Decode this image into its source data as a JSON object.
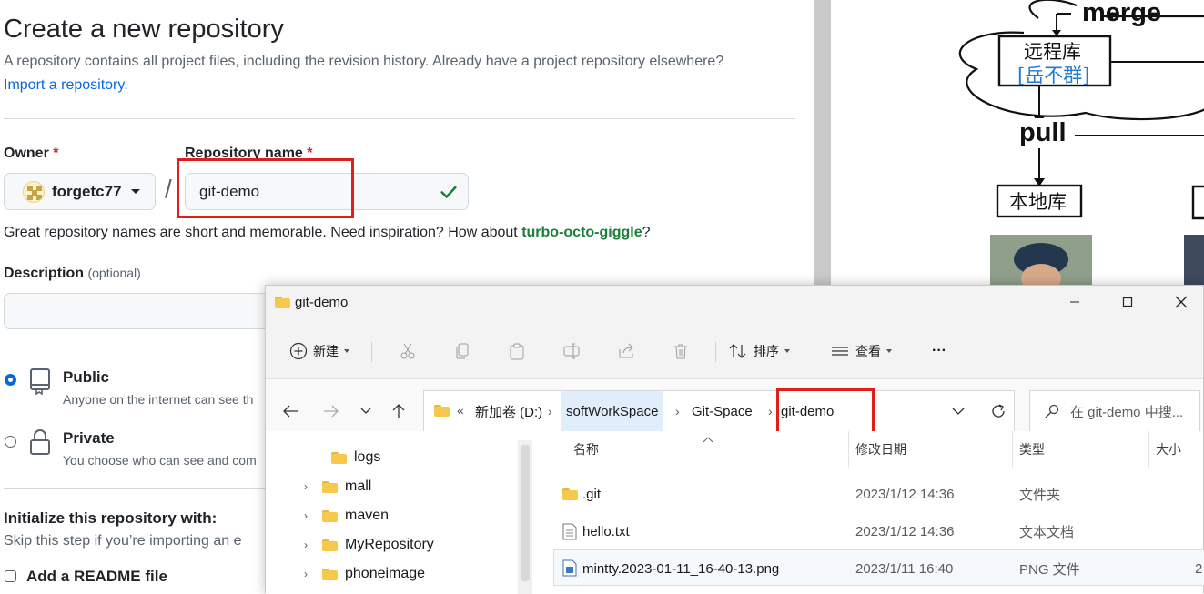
{
  "github": {
    "title": "Create a new repository",
    "subtitle": "A repository contains all project files, including the revision history. Already have a project repository elsewhere?",
    "import_link": "Import a repository.",
    "owner_label": "Owner",
    "required_mark": "*",
    "owner_value": "forgetc77",
    "repo_label": "Repository name",
    "slash": "/",
    "repo_value": "git-demo",
    "hint_prefix": "Great repository names are short and memorable. Need inspiration? How about ",
    "hint_suggestion": "turbo-octo-giggle",
    "hint_suffix": "?",
    "description_label": "Description",
    "description_optional": "(optional)",
    "public_title": "Public",
    "public_desc": "Anyone on the internet can see th",
    "private_title": "Private",
    "private_desc": "You choose who can see and com",
    "init_title": "Initialize this repository with:",
    "init_desc": "Skip this step if you’re importing an e",
    "readme_label": "Add a README file"
  },
  "diagram": {
    "merge": "merge",
    "remote_repo": "远程库",
    "remote_owner": "[岳不群]",
    "pull": "pull",
    "local_repo": "本地库"
  },
  "explorer": {
    "window_title": "git-demo",
    "toolbar": {
      "new": "新建",
      "sort": "排序",
      "view": "查看",
      "more": "···"
    },
    "breadcrumb": {
      "overflow": "«",
      "items": [
        "新加卷 (D:)",
        "softWorkSpace",
        "Git-Space",
        "git-demo"
      ]
    },
    "search_placeholder": "在 git-demo 中搜...",
    "tree": [
      "logs",
      "mall",
      "maven",
      "MyRepository",
      "phoneimage"
    ],
    "columns": {
      "name": "名称",
      "modified": "修改日期",
      "type": "类型",
      "size": "大小"
    },
    "files": [
      {
        "name": ".git",
        "modified": "2023/1/12 14:36",
        "type": "文件夹",
        "size": "",
        "icon": "folder-icon"
      },
      {
        "name": "hello.txt",
        "modified": "2023/1/12 14:36",
        "type": "文本文档",
        "size": "",
        "icon": "text-file-icon"
      },
      {
        "name": "mintty.2023-01-11_16-40-13.png",
        "modified": "2023/1/11 16:40",
        "type": "PNG 文件",
        "size": "2",
        "icon": "image-file-icon"
      }
    ]
  },
  "colors": {
    "link": "#0969da",
    "success": "#1a7f37",
    "required": "#d1242f",
    "highlight": "#e11d1d",
    "selection": "#e0eefb"
  }
}
